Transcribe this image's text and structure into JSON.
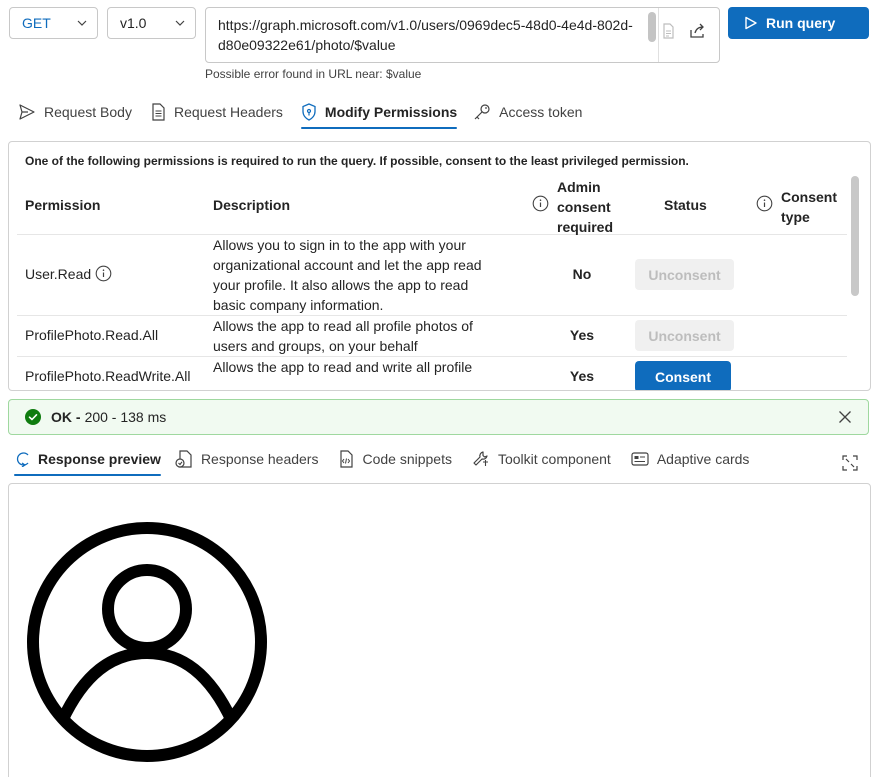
{
  "toolbar": {
    "method": "GET",
    "version": "v1.0",
    "url": "https://graph.microsoft.com/v1.0/users/0969dec5-48d0-4e4d-802d-d80e09322e61/photo/$value",
    "run_label": "Run query",
    "url_hint": "Possible error found in URL near: $value"
  },
  "request_tabs": [
    {
      "label": "Request Body",
      "icon": "send-icon"
    },
    {
      "label": "Request Headers",
      "icon": "document-icon"
    },
    {
      "label": "Modify Permissions",
      "icon": "shield-icon",
      "active": true
    },
    {
      "label": "Access token",
      "icon": "key-icon"
    }
  ],
  "permissions": {
    "note": "One of the following permissions is required to run the query. If possible, consent to the least privileged permission.",
    "headers": {
      "permission": "Permission",
      "description": "Description",
      "admin": [
        "Admin",
        "consent",
        "required"
      ],
      "status": "Status",
      "consent_type": [
        "Consent",
        "type"
      ]
    },
    "rows": [
      {
        "name": "User.Read",
        "description": "Allows you to sign in to the app with your organizational account and let the app read your profile. It also allows the app to read basic company information.",
        "admin": "No",
        "action": "Unconsent"
      },
      {
        "name": "ProfilePhoto.Read.All",
        "description": "Allows the app to read all profile photos of users and groups, on your behalf",
        "admin": "Yes",
        "action": "Unconsent"
      },
      {
        "name": "ProfilePhoto.ReadWrite.All",
        "description": "Allows the app to read and write all profile",
        "admin": "Yes",
        "action": "Consent"
      }
    ]
  },
  "status": {
    "ok": "OK -",
    "detail": "200 - 138 ms",
    "color": "#107c10"
  },
  "response_tabs": [
    {
      "label": "Response preview",
      "icon": "preview-icon",
      "active": true
    },
    {
      "label": "Response headers",
      "icon": "headers-icon"
    },
    {
      "label": "Code snippets",
      "icon": "code-icon"
    },
    {
      "label": "Toolkit component",
      "icon": "toolkit-icon"
    },
    {
      "label": "Adaptive cards",
      "icon": "card-icon"
    }
  ],
  "accent": "#0f6cbd"
}
